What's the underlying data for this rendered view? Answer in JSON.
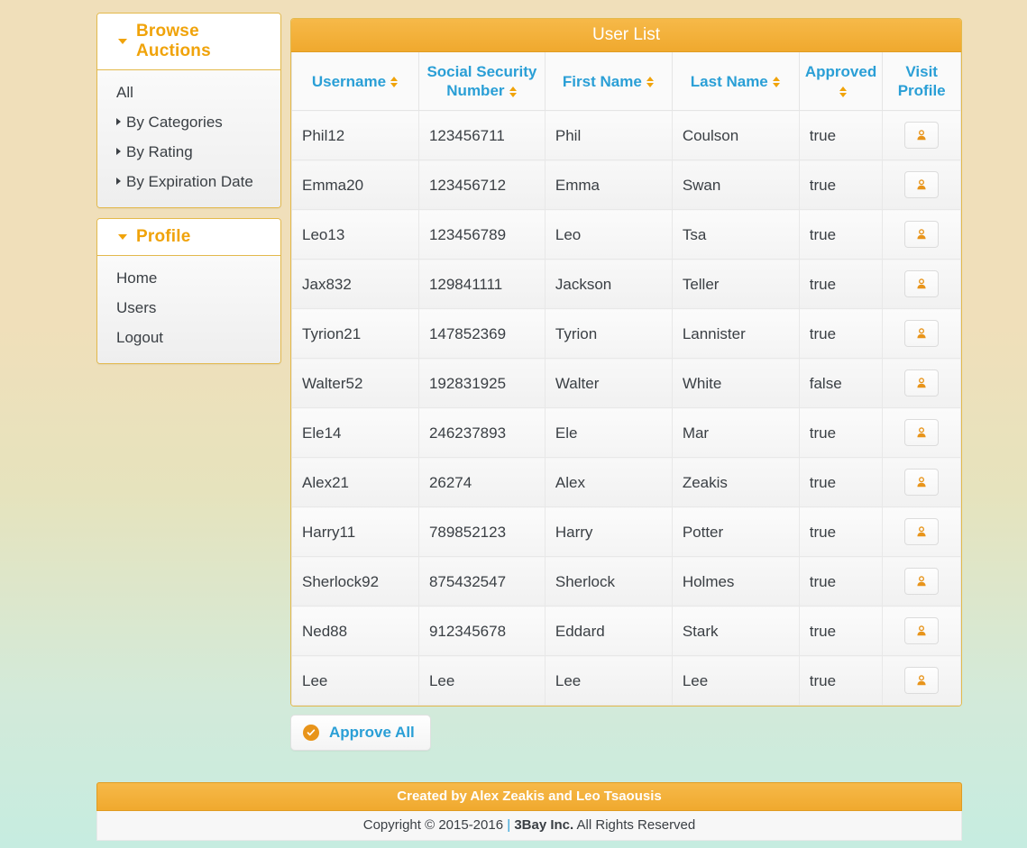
{
  "sidebar": {
    "panels": [
      {
        "title": "Browse Auctions",
        "caret_icon": "caret-down-icon",
        "items": [
          {
            "label": "All",
            "sub": false
          },
          {
            "label": "By Categories",
            "sub": true
          },
          {
            "label": "By Rating",
            "sub": true
          },
          {
            "label": "By Expiration Date",
            "sub": true
          }
        ]
      },
      {
        "title": "Profile",
        "caret_icon": "caret-down-icon",
        "items": [
          {
            "label": "Home",
            "sub": false
          },
          {
            "label": "Users",
            "sub": false
          },
          {
            "label": "Logout",
            "sub": false
          }
        ]
      }
    ]
  },
  "main": {
    "panel_title": "User List",
    "columns": [
      {
        "label": "Username",
        "sortable": true,
        "sort_icon": "sort-updown-icon"
      },
      {
        "label": "Social Security Number",
        "sortable": true,
        "sort_icon": "sort-updown-icon"
      },
      {
        "label": "First Name",
        "sortable": true,
        "sort_icon": "sort-updown-icon"
      },
      {
        "label": "Last Name",
        "sortable": true,
        "sort_icon": "sort-updown-icon"
      },
      {
        "label": "Approved",
        "sortable": true,
        "sort_icon": "sort-updown-icon"
      },
      {
        "label": "Visit Profile",
        "sortable": false,
        "sort_icon": null
      }
    ],
    "rows": [
      {
        "username": "Phil12",
        "ssn": "123456711",
        "first_name": "Phil",
        "last_name": "Coulson",
        "approved": "true",
        "visit_icon": "user-icon"
      },
      {
        "username": "Emma20",
        "ssn": "123456712",
        "first_name": "Emma",
        "last_name": "Swan",
        "approved": "true",
        "visit_icon": "user-icon"
      },
      {
        "username": "Leo13",
        "ssn": "123456789",
        "first_name": "Leo",
        "last_name": "Tsa",
        "approved": "true",
        "visit_icon": "user-icon"
      },
      {
        "username": "Jax832",
        "ssn": "129841111",
        "first_name": "Jackson",
        "last_name": "Teller",
        "approved": "true",
        "visit_icon": "user-icon"
      },
      {
        "username": "Tyrion21",
        "ssn": "147852369",
        "first_name": "Tyrion",
        "last_name": "Lannister",
        "approved": "true",
        "visit_icon": "user-icon"
      },
      {
        "username": "Walter52",
        "ssn": "192831925",
        "first_name": "Walter",
        "last_name": "White",
        "approved": "false",
        "visit_icon": "user-icon"
      },
      {
        "username": "Ele14",
        "ssn": "246237893",
        "first_name": "Ele",
        "last_name": "Mar",
        "approved": "true",
        "visit_icon": "user-icon"
      },
      {
        "username": "Alex21",
        "ssn": "26274",
        "first_name": "Alex",
        "last_name": "Zeakis",
        "approved": "true",
        "visit_icon": "user-icon"
      },
      {
        "username": "Harry11",
        "ssn": "789852123",
        "first_name": "Harry",
        "last_name": "Potter",
        "approved": "true",
        "visit_icon": "user-icon"
      },
      {
        "username": "Sherlock92",
        "ssn": "875432547",
        "first_name": "Sherlock",
        "last_name": "Holmes",
        "approved": "true",
        "visit_icon": "user-icon"
      },
      {
        "username": "Ned88",
        "ssn": "912345678",
        "first_name": "Eddard",
        "last_name": "Stark",
        "approved": "true",
        "visit_icon": "user-icon"
      },
      {
        "username": "Lee",
        "ssn": "Lee",
        "first_name": "Lee",
        "last_name": "Lee",
        "approved": "true",
        "visit_icon": "user-icon"
      }
    ],
    "approve_all": {
      "label": "Approve All",
      "icon": "check-circle-icon"
    }
  },
  "footer": {
    "credits": "Created by Alex Zeakis and Leo Tsaousis",
    "copyright_prefix": "Copyright © 2015-2016 ",
    "separator": "|",
    "company": "3Bay Inc.",
    "rights": " All Rights Reserved"
  },
  "colors": {
    "accent_orange": "#f0a30a",
    "panel_orange": "#f0a92e",
    "link_blue": "#2a9fd6",
    "text_dark": "#3a3f44",
    "panel_border": "#e3b94c"
  }
}
